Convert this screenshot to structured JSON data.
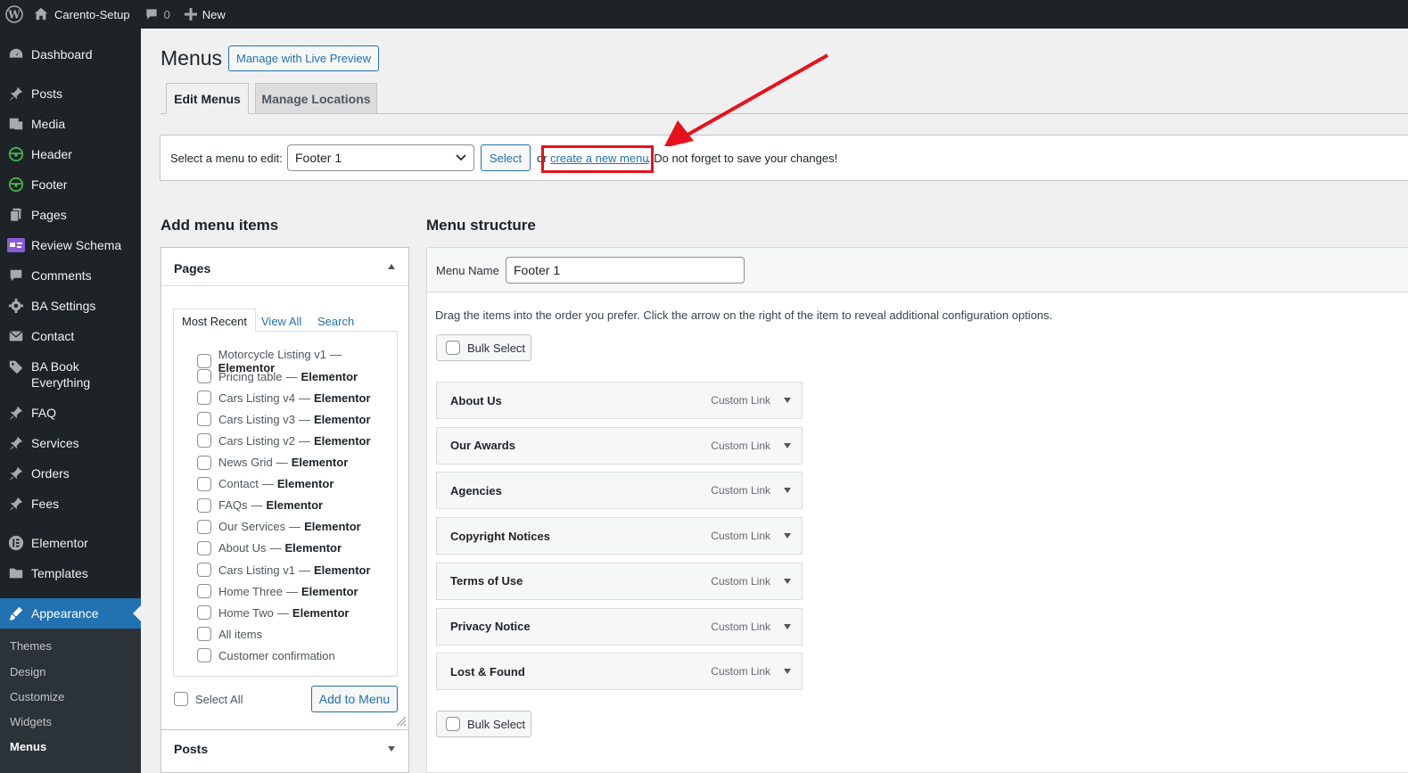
{
  "admin_bar": {
    "site_name": "Carento-Setup",
    "comment_count": "0",
    "new_label": "New"
  },
  "sidebar": {
    "items": [
      {
        "label": "Dashboard",
        "icon": "dashboard-icon"
      },
      {
        "label": "Posts",
        "icon": "pin-icon"
      },
      {
        "label": "Media",
        "icon": "media-icon"
      },
      {
        "label": "Header",
        "icon": "steering-wheel-icon"
      },
      {
        "label": "Footer",
        "icon": "steering-wheel-icon"
      },
      {
        "label": "Pages",
        "icon": "pages-icon"
      },
      {
        "label": "Review Schema",
        "icon": "review-schema-icon"
      },
      {
        "label": "Comments",
        "icon": "comment-icon"
      },
      {
        "label": "BA Settings",
        "icon": "gear-icon"
      },
      {
        "label": "Contact",
        "icon": "mail-icon"
      },
      {
        "label": "BA Book Everything",
        "label_line1": "BA Book",
        "label_line2": "Everything",
        "icon": "tag-icon"
      },
      {
        "label": "FAQ",
        "icon": "pin-icon"
      },
      {
        "label": "Services",
        "icon": "pin-icon"
      },
      {
        "label": "Orders",
        "icon": "pin-icon"
      },
      {
        "label": "Fees",
        "icon": "pin-icon"
      },
      {
        "label": "Elementor",
        "icon": "elementor-icon"
      },
      {
        "label": "Templates",
        "icon": "folder-icon"
      },
      {
        "label": "Appearance",
        "icon": "paintbrush-icon"
      }
    ],
    "submenu": [
      "Themes",
      "Design",
      "Customize",
      "Widgets",
      "Menus"
    ]
  },
  "header": {
    "title": "Menus",
    "live_preview_button": "Manage with Live Preview",
    "tabs": [
      "Edit Menus",
      "Manage Locations"
    ]
  },
  "select_bar": {
    "label": "Select a menu to edit:",
    "selected_menu": "Footer 1",
    "select_button": "Select",
    "or_text": "or",
    "create_link": "create a new menu",
    "save_note": ". Do not forget to save your changes!"
  },
  "add_items": {
    "title": "Add menu items",
    "pages_panel": {
      "title": "Pages",
      "tabs": [
        "Most Recent",
        "View All",
        "Search"
      ],
      "items": [
        {
          "name": "Motorcycle Listing v1",
          "suffix": "Elementor"
        },
        {
          "name": "Pricing table",
          "suffix": "Elementor"
        },
        {
          "name": "Cars Listing v4",
          "suffix": "Elementor"
        },
        {
          "name": "Cars Listing v3",
          "suffix": "Elementor"
        },
        {
          "name": "Cars Listing v2",
          "suffix": "Elementor"
        },
        {
          "name": "News Grid",
          "suffix": "Elementor"
        },
        {
          "name": "Contact",
          "suffix": "Elementor"
        },
        {
          "name": "FAQs",
          "suffix": "Elementor"
        },
        {
          "name": "Our Services",
          "suffix": "Elementor"
        },
        {
          "name": "About Us",
          "suffix": "Elementor"
        },
        {
          "name": "Cars Listing v1",
          "suffix": "Elementor"
        },
        {
          "name": "Home Three",
          "suffix": "Elementor"
        },
        {
          "name": "Home Two",
          "suffix": "Elementor"
        },
        {
          "name": "All items",
          "suffix": ""
        },
        {
          "name": "Customer confirmation",
          "suffix": ""
        }
      ],
      "dash": "—",
      "select_all": "Select All",
      "add_button": "Add to Menu"
    },
    "posts_panel_title": "Posts"
  },
  "structure": {
    "title": "Menu structure",
    "menu_name_label": "Menu Name",
    "menu_name_value": "Footer 1",
    "instructions": "Drag the items into the order you prefer. Click the arrow on the right of the item to reveal additional configuration options.",
    "bulk_select": "Bulk Select",
    "items": [
      {
        "title": "About Us",
        "type": "Custom Link"
      },
      {
        "title": "Our Awards",
        "type": "Custom Link"
      },
      {
        "title": "Agencies",
        "type": "Custom Link"
      },
      {
        "title": "Copyright Notices",
        "type": "Custom Link"
      },
      {
        "title": "Terms of Use",
        "type": "Custom Link"
      },
      {
        "title": "Privacy Notice",
        "type": "Custom Link"
      },
      {
        "title": "Lost & Found",
        "type": "Custom Link"
      }
    ]
  },
  "colors": {
    "admin_dark": "#1d2327",
    "accent_blue": "#2271b1",
    "annotation_red": "#e8111b"
  }
}
